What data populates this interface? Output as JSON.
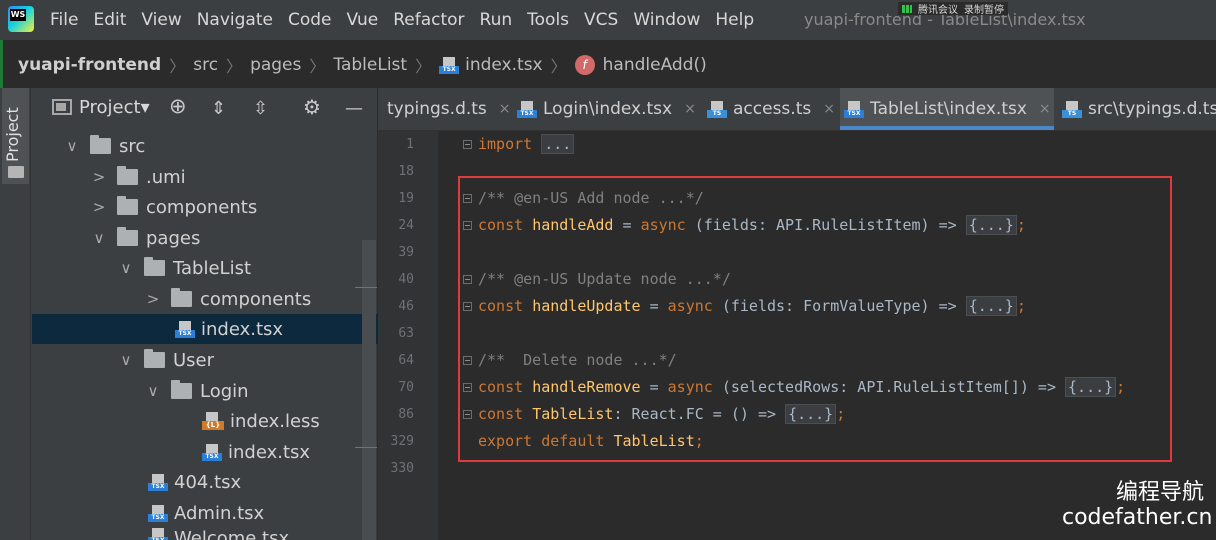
{
  "app": {
    "logo_text": "WS",
    "menu": [
      "File",
      "Edit",
      "View",
      "Navigate",
      "Code",
      "Vue",
      "Refactor",
      "Run",
      "Tools",
      "VCS",
      "Window",
      "Help"
    ],
    "window_title": "yuapi-frontend - TableList\\index.tsx",
    "overlay_badge": [
      "腾讯会议",
      "录制暂停"
    ]
  },
  "breadcrumb": {
    "items": [
      "yuapi-frontend",
      "src",
      "pages",
      "TableList",
      "index.tsx",
      "handleAdd()"
    ],
    "tsx_label": "TSX"
  },
  "project": {
    "strip_label": "Project",
    "title": "Project▾",
    "toolbar": {
      "target": "⊕",
      "expand": "⇕",
      "collapse": "⇳",
      "gear": "⚙",
      "minimize": "—"
    },
    "tree": [
      {
        "label": "src",
        "chev": "∨",
        "kind": "folder"
      },
      {
        "label": ".umi",
        "chev": ">",
        "kind": "folder"
      },
      {
        "label": "components",
        "chev": ">",
        "kind": "folder"
      },
      {
        "label": "pages",
        "chev": "∨",
        "kind": "folder"
      },
      {
        "label": "TableList",
        "chev": "∨",
        "kind": "folder"
      },
      {
        "label": "components",
        "chev": ">",
        "kind": "folder"
      },
      {
        "label": "index.tsx",
        "chev": "",
        "kind": "tsx"
      },
      {
        "label": "User",
        "chev": "∨",
        "kind": "folder"
      },
      {
        "label": "Login",
        "chev": "∨",
        "kind": "folder"
      },
      {
        "label": "index.less",
        "chev": "",
        "kind": "less"
      },
      {
        "label": "index.tsx",
        "chev": "",
        "kind": "tsx"
      },
      {
        "label": "404.tsx",
        "chev": "",
        "kind": "tsx"
      },
      {
        "label": "Admin.tsx",
        "chev": "",
        "kind": "tsx"
      },
      {
        "label": "Welcome.tsx",
        "chev": "",
        "kind": "tsx"
      }
    ],
    "less_label": "{L}",
    "ts_label": "TS"
  },
  "tabs": [
    {
      "label": "typings.d.ts",
      "badge": ""
    },
    {
      "label": "Login\\index.tsx",
      "badge": "TSX"
    },
    {
      "label": "access.ts",
      "badge": "TS"
    },
    {
      "label": "TableList\\index.tsx",
      "badge": "TSX"
    },
    {
      "label": "src\\typings.d.ts",
      "badge": "TS"
    }
  ],
  "tab_close": "×",
  "editor": {
    "line_numbers": [
      "1",
      "18",
      "19",
      "24",
      "39",
      "40",
      "46",
      "63",
      "64",
      "70",
      "86",
      "329",
      "330"
    ],
    "lines": {
      "l1": {
        "kw": "import",
        "rest": " ",
        "fold": "..."
      },
      "l19": "/** @en-US Add node ...*/",
      "l24": {
        "kw": "const",
        "name": "handleAdd",
        "op": " = ",
        "async": "async",
        "args": " (fields: API.RuleListItem) => ",
        "fold": "{...}",
        "end": ";"
      },
      "l40": "/** @en-US Update node ...*/",
      "l46": {
        "kw": "const",
        "name": "handleUpdate",
        "op": " = ",
        "async": "async",
        "args": " (fields: FormValueType) => ",
        "fold": "{...}",
        "end": ";"
      },
      "l64": "/**  Delete node ...*/",
      "l70": {
        "kw": "const",
        "name": "handleRemove",
        "op": " = ",
        "async": "async",
        "args": " (selectedRows: API.RuleListItem[]) => ",
        "fold": "{...}",
        "end": ";"
      },
      "l86": {
        "kw": "const",
        "name": "TableList",
        "rest": ": React.FC = () => ",
        "fold": "{...}",
        "end": ";"
      },
      "l329": {
        "kw1": "export",
        "kw2": "default",
        "name": "TableList",
        "end": ";"
      }
    }
  },
  "watermark": {
    "line1": "编程导航",
    "line2": "codefather.cn"
  }
}
